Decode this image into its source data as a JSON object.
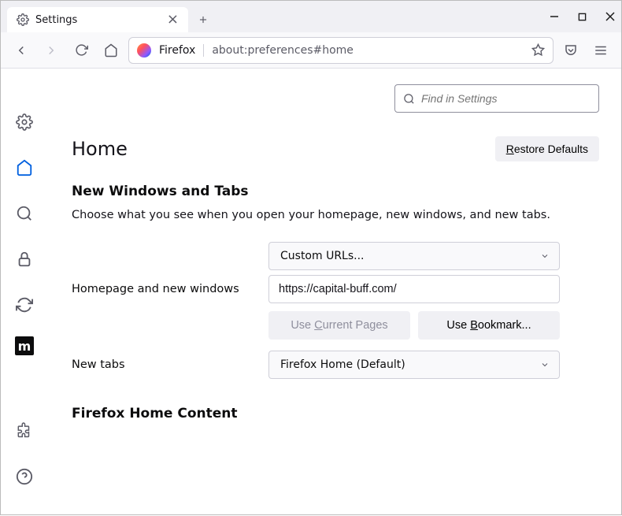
{
  "tab": {
    "title": "Settings"
  },
  "urlbar": {
    "identity": "Firefox",
    "url": "about:preferences#home"
  },
  "search": {
    "placeholder": "Find in Settings"
  },
  "header": {
    "title": "Home",
    "restore_label": "Restore Defaults"
  },
  "section": {
    "subtitle": "New Windows and Tabs",
    "desc": "Choose what you see when you open your homepage, new windows, and new tabs."
  },
  "form": {
    "homepage_label": "Homepage and new windows",
    "homepage_mode": "Custom URLs...",
    "homepage_value": "https://capital-buff.com/",
    "use_current": "Use Current Pages",
    "use_bookmark": "Use Bookmark...",
    "newtabs_label": "New tabs",
    "newtabs_mode": "Firefox Home (Default)"
  },
  "section2": {
    "title": "Firefox Home Content"
  }
}
